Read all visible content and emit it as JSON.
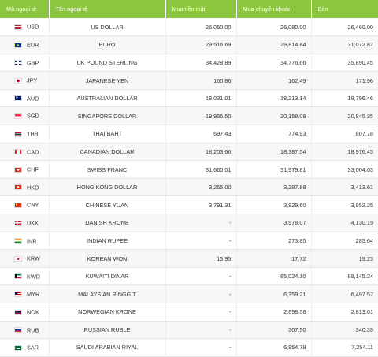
{
  "table": {
    "headers": [
      "Mã ngoại tệ",
      "Tên ngoại tệ",
      "Mua tiền mặt",
      "Mua chuyển khoản",
      "Bán"
    ],
    "rows": [
      {
        "code": "USD",
        "name": "US DOLLAR",
        "cash": "26,050.00",
        "transfer": "26,080.00",
        "sell": "26,460.00",
        "flag": "us-flag-icon"
      },
      {
        "code": "EUR",
        "name": "EURO",
        "cash": "29,516.69",
        "transfer": "29,814.84",
        "sell": "31,072.87",
        "flag": "eu-flag-icon"
      },
      {
        "code": "GBP",
        "name": "UK POUND STERLING",
        "cash": "34,428.89",
        "transfer": "34,776.66",
        "sell": "35,890.45",
        "flag": "gb-flag-icon"
      },
      {
        "code": "JPY",
        "name": "JAPANESE YEN",
        "cash": "160.86",
        "transfer": "162.49",
        "sell": "171.96",
        "flag": "jp-flag-icon"
      },
      {
        "code": "AUD",
        "name": "AUSTRALIAN DOLLAR",
        "cash": "18,031.01",
        "transfer": "18,213.14",
        "sell": "18,796.46",
        "flag": "au-flag-icon"
      },
      {
        "code": "SGD",
        "name": "SINGAPORE DOLLAR",
        "cash": "19,956.50",
        "transfer": "20,158.08",
        "sell": "20,845.35",
        "flag": "sg-flag-icon"
      },
      {
        "code": "THB",
        "name": "THAI BAHT",
        "cash": "697.43",
        "transfer": "774.93",
        "sell": "807.78",
        "flag": "th-flag-icon"
      },
      {
        "code": "CAD",
        "name": "CANADIAN DOLLAR",
        "cash": "18,203.66",
        "transfer": "18,387.54",
        "sell": "18,976.43",
        "flag": "ca-flag-icon"
      },
      {
        "code": "CHF",
        "name": "SWISS FRANC",
        "cash": "31,660.01",
        "transfer": "31,979.81",
        "sell": "33,004.03",
        "flag": "ch-flag-icon"
      },
      {
        "code": "HKD",
        "name": "HONG KONG DOLLAR",
        "cash": "3,255.00",
        "transfer": "3,287.88",
        "sell": "3,413.61",
        "flag": "hk-flag-icon"
      },
      {
        "code": "CNY",
        "name": "CHINESE YUAN",
        "cash": "3,791.31",
        "transfer": "3,829.60",
        "sell": "3,952.25",
        "flag": "cn-flag-icon"
      },
      {
        "code": "DKK",
        "name": "DANISH KRONE",
        "cash": "-",
        "transfer": "3,978.07",
        "sell": "4,130.19",
        "flag": "dk-flag-icon"
      },
      {
        "code": "INR",
        "name": "INDIAN RUPEE",
        "cash": "-",
        "transfer": "273.85",
        "sell": "285.64",
        "flag": "in-flag-icon"
      },
      {
        "code": "KRW",
        "name": "KOREAN WON",
        "cash": "15.95",
        "transfer": "17.72",
        "sell": "19.23",
        "flag": "kr-flag-icon"
      },
      {
        "code": "KWD",
        "name": "KUWAITI DINAR",
        "cash": "-",
        "transfer": "85,024.10",
        "sell": "89,145.24",
        "flag": "kw-flag-icon"
      },
      {
        "code": "MYR",
        "name": "MALAYSIAN RINGGIT",
        "cash": "-",
        "transfer": "6,359.21",
        "sell": "6,497.57",
        "flag": "my-flag-icon"
      },
      {
        "code": "NOK",
        "name": "NORWEGIAN KRONE",
        "cash": "-",
        "transfer": "2,698.58",
        "sell": "2,813.01",
        "flag": "no-flag-icon"
      },
      {
        "code": "RUB",
        "name": "RUSSIAN RUBLE",
        "cash": "-",
        "transfer": "307.50",
        "sell": "340.39",
        "flag": "ru-flag-icon"
      },
      {
        "code": "SAR",
        "name": "SAUDI ARABIAN RIYAL",
        "cash": "-",
        "transfer": "6,954.79",
        "sell": "7,254.11",
        "flag": "sa-flag-icon"
      }
    ]
  },
  "flag_styles": {
    "us-flag-icon": "repeating-linear-gradient(#b22234 0 1px,#ffffff 1px 2px)",
    "eu-flag-icon": "radial-gradient(circle,#ffcc00 0 1.2px,#003399 1.3px)",
    "gb-flag-icon": "linear-gradient(#ffffff 0 0) center/100% 2px no-repeat, linear-gradient(#ffffff 0 0) center/2px 100% no-repeat, #012169",
    "jp-flag-icon": "radial-gradient(circle,#bc002d 0 1.8px,#ffffff 1.9px)",
    "au-flag-icon": "radial-gradient(circle at 30% 30%,#ffffff 0 1px,#012169 1.1px)",
    "sg-flag-icon": "linear-gradient(#ef3340 50%,#ffffff 50%)",
    "th-flag-icon": "linear-gradient(#a51931 0 17%,#f4f5f8 17% 33%,#2d2a4a 33% 67%,#f4f5f8 67% 83%,#a51931 83%)",
    "ca-flag-icon": "linear-gradient(90deg,#d52b1e 0 25%,#ffffff 25% 75%,#d52b1e 75%)",
    "ch-flag-icon": "radial-gradient(circle,#ffffff 0 1.3px,#d52b1e 1.4px)",
    "hk-flag-icon": "radial-gradient(circle,#ffffff 0 1.4px,#de2910 1.5px)",
    "cn-flag-icon": "radial-gradient(circle at 25% 30%,#ffde00 0 1.1px,#de2910 1.2px)",
    "dk-flag-icon": "linear-gradient(#ffffff 0 0) 35% 50%/1.5px 100% no-repeat, linear-gradient(#ffffff 0 0) center/100% 1.5px no-repeat, #c8102e",
    "in-flag-icon": "linear-gradient(#ff9933 0 33%,#ffffff 33% 67%,#138808 67%)",
    "kr-flag-icon": "radial-gradient(circle,#cd2e3a 0 1.6px,#ffffff 1.7px)",
    "kw-flag-icon": "linear-gradient(90deg,#000000 0 22%,transparent 22%), linear-gradient(#007a3d 0 33%,#ffffff 33% 67%,#ce1126 67%)",
    "my-flag-icon": "linear-gradient(90deg,#010066 0 45%,transparent 45%) 0 0/100% 55% no-repeat, repeating-linear-gradient(#cc0001 0 1px,#ffffff 1px 2px)",
    "no-flag-icon": "linear-gradient(#00205b 0 0) 35% 50%/1.5px 100% no-repeat, linear-gradient(#00205b 0 0) center/100% 1.5px no-repeat, #ba0c2f",
    "ru-flag-icon": "linear-gradient(#ffffff 0 33%,#0039a6 33% 67%,#d52b1e 67%)",
    "sa-flag-icon": "linear-gradient(#ffffff 0 0) center 70%/60% 1px no-repeat, #006c35"
  }
}
